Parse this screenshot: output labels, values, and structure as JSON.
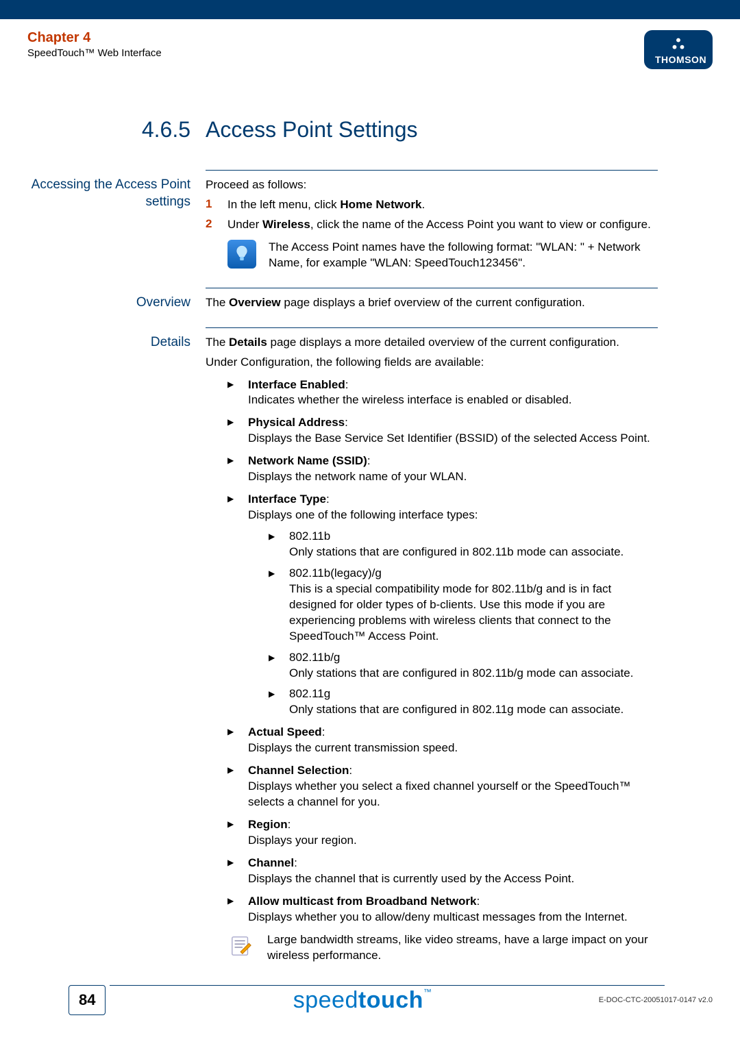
{
  "header": {
    "chapter": "Chapter 4",
    "subtitle": "SpeedTouch™ Web Interface",
    "brand": "THOMSON"
  },
  "section": {
    "number": "4.6.5",
    "title": "Access Point Settings"
  },
  "blocks": {
    "accessing": {
      "label": "Accessing the Access Point settings",
      "intro": "Proceed as follows:",
      "step1_num": "1",
      "step1_a": "In the left menu, click ",
      "step1_b": "Home Network",
      "step1_c": ".",
      "step2_num": "2",
      "step2_a": "Under ",
      "step2_b": "Wireless",
      "step2_c": ", click the name of the Access Point you want to view or configure.",
      "tip": "The Access Point names have the following format: \"WLAN: \" + Network Name, for example \"WLAN: SpeedTouch123456\"."
    },
    "overview": {
      "label": "Overview",
      "text_a": "The ",
      "text_b": "Overview",
      "text_c": " page displays a brief overview of the current configuration."
    },
    "details": {
      "label": "Details",
      "intro_a": "The ",
      "intro_b": "Details",
      "intro_c": " page displays a more detailed overview of the current configuration.",
      "sub_intro": "Under Configuration, the following fields are available:",
      "items": {
        "i1_title": "Interface Enabled",
        "i1_body": "Indicates whether the wireless interface is enabled or disabled.",
        "i2_title": "Physical Address",
        "i2_body": "Displays the Base Service Set Identifier (BSSID) of the selected Access Point.",
        "i3_title": "Network Name (SSID)",
        "i3_body": "Displays the network name of your WLAN.",
        "i4_title": "Interface Type",
        "i4_body": "Displays one of the following interface types:",
        "i4_s1_t": "802.11b",
        "i4_s1_b": "Only stations that are configured in 802.11b mode can associate.",
        "i4_s2_t": "802.11b(legacy)/g",
        "i4_s2_b": "This is a special compatibility mode for 802.11b/g and is in fact designed for older types of b-clients. Use this mode if you are experiencing problems with wireless clients that connect to the SpeedTouch™ Access Point.",
        "i4_s3_t": "802.11b/g",
        "i4_s3_b": "Only stations that are configured in 802.11b/g mode can associate.",
        "i4_s4_t": "802.11g",
        "i4_s4_b": "Only stations that are configured in 802.11g mode can associate.",
        "i5_title": "Actual Speed",
        "i5_body": "Displays the current transmission speed.",
        "i6_title": "Channel Selection",
        "i6_body": "Displays whether you select a fixed channel yourself or the SpeedTouch™ selects a channel for you.",
        "i7_title": "Region",
        "i7_body": "Displays your region.",
        "i8_title": "Channel",
        "i8_body": "Displays the channel that is currently used by the Access Point.",
        "i9_title": "Allow multicast from Broadband Network",
        "i9_body": "Displays whether you to allow/deny multicast messages from the Internet.",
        "note": "Large bandwidth streams, like video streams, have a large impact on your wireless performance."
      }
    }
  },
  "footer": {
    "page": "84",
    "brand_a": "speed",
    "brand_b": "touch",
    "tm": "™",
    "docid": "E-DOC-CTC-20051017-0147 v2.0"
  }
}
